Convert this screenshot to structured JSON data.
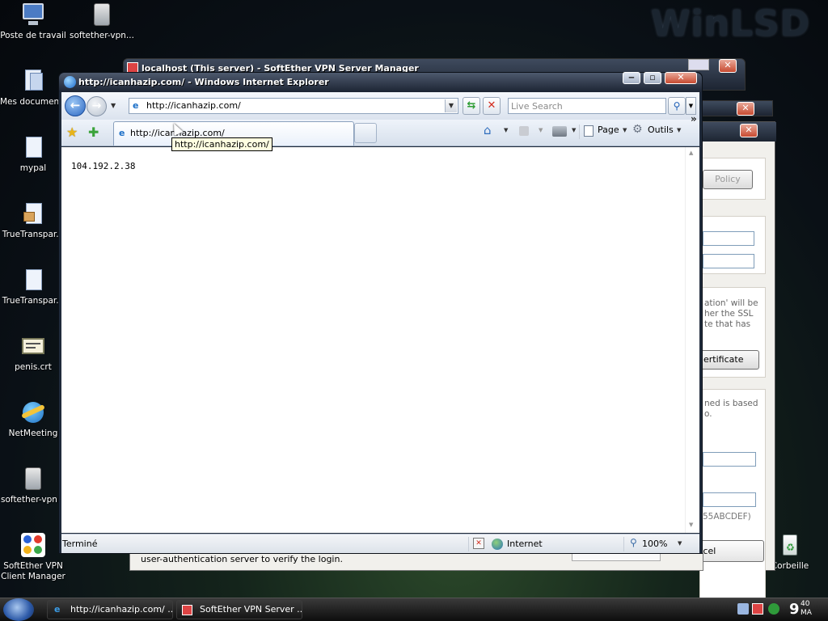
{
  "desktop": {
    "watermark": "WinLSD",
    "icons": [
      {
        "label": "Poste de travail"
      },
      {
        "label": "softether-vpn..."
      },
      {
        "label": "Mes documents"
      },
      {
        "label": "mypal"
      },
      {
        "label": "TrueTranspar..."
      },
      {
        "label": "TrueTranspar..."
      },
      {
        "label": "penis.crt"
      },
      {
        "label": "NetMeeting"
      },
      {
        "label": "softether-vpn..."
      },
      {
        "label": "SoftEther VPN Client Manager"
      },
      {
        "label": "Corbeille"
      }
    ]
  },
  "bg_window": {
    "title": "localhost (This server) - SoftEther VPN Server Manager",
    "policy_button": "Policy",
    "ssl_text": [
      "ation' will be",
      "her the SSL",
      "te that has"
    ],
    "certificate_button": "ertificate",
    "based_text": [
      "ned is based",
      "o."
    ],
    "hex_hint": "55ABCDEF)",
    "bottom_text": "user-authentication server to verify the login.",
    "cancel_button": "Cancel"
  },
  "ie": {
    "title": "http://icanhazip.com/ - Windows Internet Explorer",
    "address": "http://icanhazip.com/",
    "search_placeholder": "Live Search",
    "tab_label": "http://icanhazip.com/",
    "tooltip": "http://icanhazip.com/",
    "content": "104.192.2.38",
    "toolbar": {
      "page": "Page",
      "tools": "Outils"
    },
    "status": {
      "text": "Terminé",
      "zone": "Internet",
      "zoom": "100%"
    }
  },
  "taskbar": {
    "items": [
      {
        "label": "http://icanhazip.com/ ..."
      },
      {
        "label": "SoftEther VPN Server ..."
      }
    ],
    "clock": {
      "hour": "9",
      "minutes": "40",
      "ampm": "MA"
    }
  },
  "colors": {
    "ie_frame": "#1f2a3a",
    "taskbar": "#1a1a1a",
    "tooltip_bg": "#ffffe1",
    "content_bg": "#ffffff"
  }
}
